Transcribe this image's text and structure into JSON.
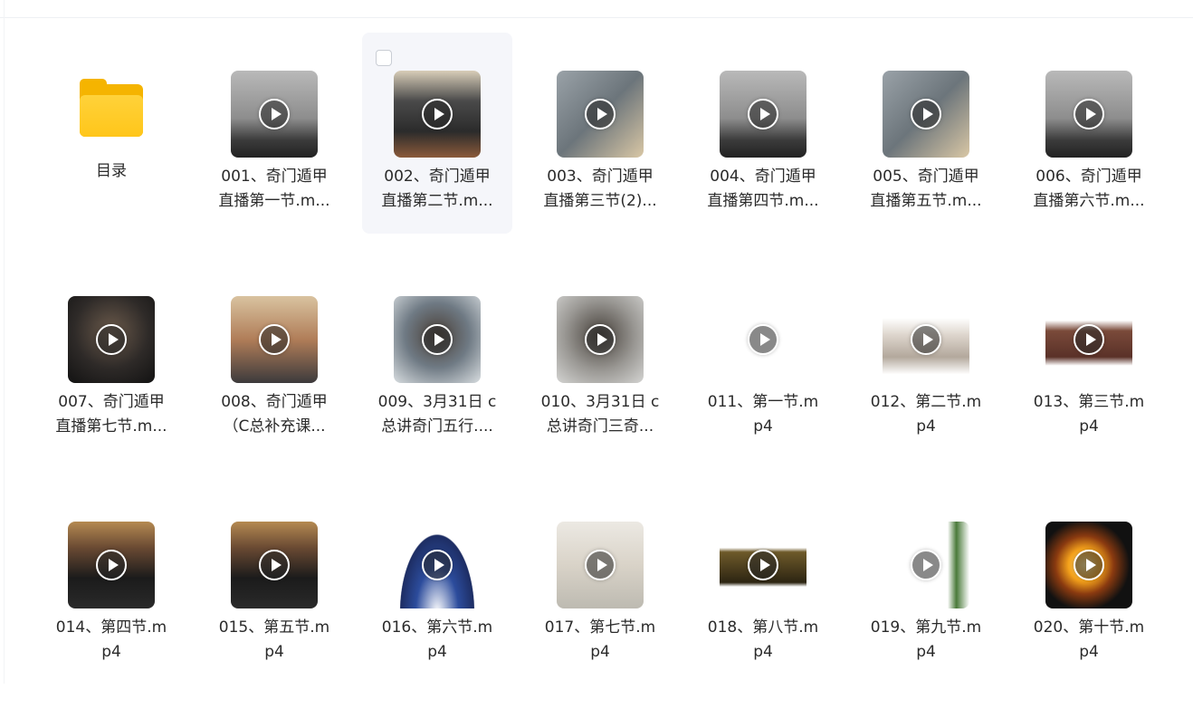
{
  "folder": {
    "label": "目录"
  },
  "files": [
    {
      "name_line1": "001、奇门遁甲",
      "name_line2": "直播第一节.m...",
      "thumb": "bg-board"
    },
    {
      "name_line1": "002、奇门遁甲",
      "name_line2": "直播第二节.m...",
      "thumb": "bg-class"
    },
    {
      "name_line1": "003、奇门遁甲",
      "name_line2": "直播第三节(2)...",
      "thumb": "bg-class2"
    },
    {
      "name_line1": "004、奇门遁甲",
      "name_line2": "直播第四节.m...",
      "thumb": "bg-board"
    },
    {
      "name_line1": "005、奇门遁甲",
      "name_line2": "直播第五节.m...",
      "thumb": "bg-class2"
    },
    {
      "name_line1": "006、奇门遁甲",
      "name_line2": "直播第六节.m...",
      "thumb": "bg-board"
    },
    {
      "name_line1": "007、奇门遁甲",
      "name_line2": "直播第七节.m...",
      "thumb": "bg-face"
    },
    {
      "name_line1": "008、奇门遁甲",
      "name_line2": "（C总补充课...",
      "thumb": "bg-room"
    },
    {
      "name_line1": "009、3月31日 c",
      "name_line2": "总讲奇门五行....",
      "thumb": "bg-face2"
    },
    {
      "name_line1": "010、3月31日 c",
      "name_line2": "总讲奇门三奇...",
      "thumb": "bg-face3"
    },
    {
      "name_line1": "011、第一节.m",
      "name_line2": "p4",
      "thumb": "bg-slide"
    },
    {
      "name_line1": "012、第二节.m",
      "name_line2": "p4",
      "thumb": "bg-slide2"
    },
    {
      "name_line1": "013、第三节.m",
      "name_line2": "p4",
      "thumb": "bg-slide3"
    },
    {
      "name_line1": "014、第四节.m",
      "name_line2": "p4",
      "thumb": "bg-book"
    },
    {
      "name_line1": "015、第五节.m",
      "name_line2": "p4",
      "thumb": "bg-book"
    },
    {
      "name_line1": "016、第六节.m",
      "name_line2": "p4",
      "thumb": "bg-sky"
    },
    {
      "name_line1": "017、第七节.m",
      "name_line2": "p4",
      "thumb": "bg-pale"
    },
    {
      "name_line1": "018、第八节.m",
      "name_line2": "p4",
      "thumb": "bg-wood"
    },
    {
      "name_line1": "019、第九节.m",
      "name_line2": "p4",
      "thumb": "bg-tree"
    },
    {
      "name_line1": "020、第十节.m",
      "name_line2": "p4",
      "thumb": "bg-fire"
    }
  ]
}
